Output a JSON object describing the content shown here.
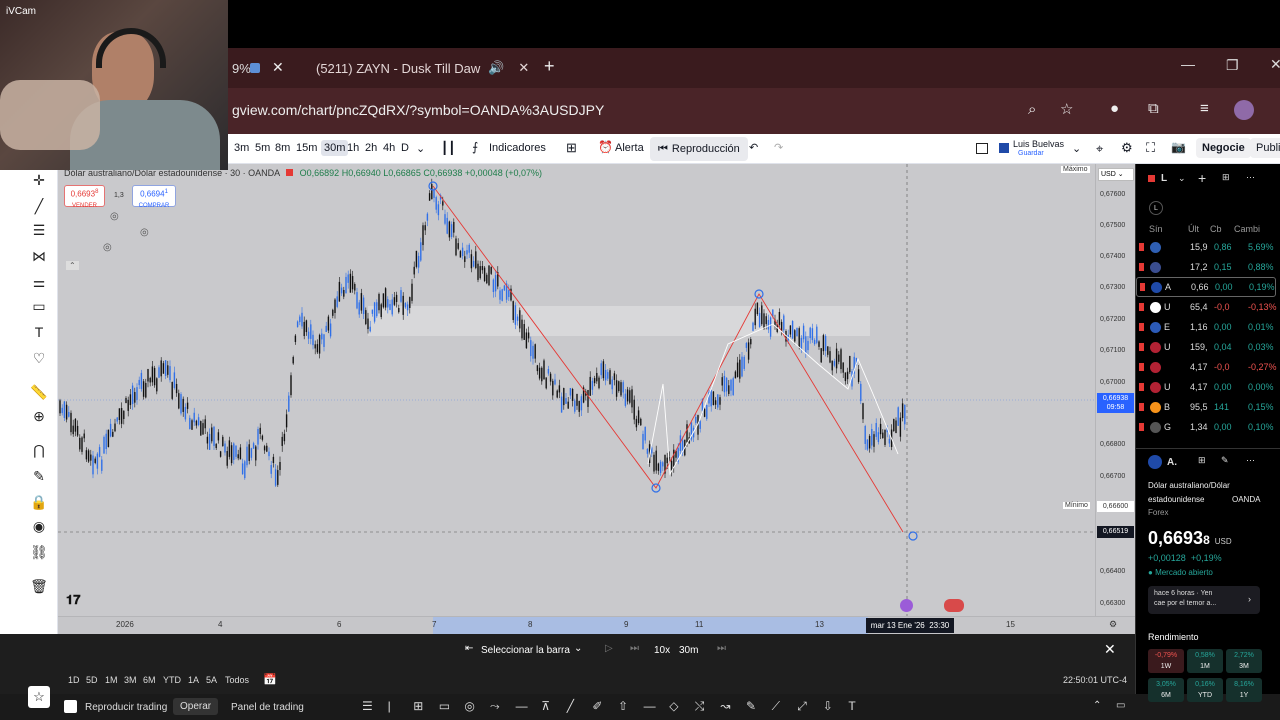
{
  "webcam": {
    "label": "iVCam"
  },
  "browser": {
    "tab_active_fragment": "9%",
    "tab2_title": "(5211) ZAYN - Dusk Till Daw",
    "url": "gview.com/chart/pncZQdRX/?symbol=OANDA%3AUSDJPY"
  },
  "toolbar": {
    "intervals": [
      "3m",
      "5m",
      "8m",
      "15m",
      "30m",
      "1h",
      "2h",
      "4h",
      "D"
    ],
    "active_interval": "30m",
    "indicators": "Indicadores",
    "alert": "Alerta",
    "replay": "Reproducción",
    "user_name": "Luis Buelvas",
    "user_sub": "Guardar",
    "trade": "Negocie",
    "publish": "Publica"
  },
  "legend": {
    "symbol": "Dólar australiano/Dólar estadounidense · 30 · OANDA",
    "o": "O0,66892",
    "h": "H0,66940",
    "l": "L0,66865",
    "c": "C0,66938",
    "chg": "+0,00048 (+0,07%)",
    "sell_price": "0,6693",
    "sell_sup": "8",
    "sell_label": "VENDER",
    "spread": "1,3",
    "buy_price": "0,6694",
    "buy_sup": "1",
    "buy_label": "COMPRAR"
  },
  "price_axis": {
    "currency": "USD",
    "max_label": "Máximo",
    "min_label": "Mínimo",
    "min_value": "0,66600",
    "ticks": [
      "0,67600",
      "0,67500",
      "0,67400",
      "0,67300",
      "0,67200",
      "0,67100",
      "0,67000",
      "0,66800",
      "0,66700",
      "0,66400",
      "0,66300"
    ],
    "current_price": "0,66938",
    "current_time": "09:58",
    "dashed_level": "0,66519"
  },
  "time_axis": {
    "labels": [
      "2026",
      "4",
      "6",
      "7",
      "8",
      "9",
      "11",
      "13",
      "15"
    ],
    "crosshair": "mar 13 Ene '26",
    "crosshair_time": "23:30"
  },
  "replay_bar": {
    "select_bar": "Seleccionar la barra",
    "speed": "10x",
    "interval": "30m"
  },
  "range_bar": {
    "ranges": [
      "1D",
      "5D",
      "1M",
      "3M",
      "6M",
      "YTD",
      "1A",
      "5A",
      "Todos"
    ],
    "clock": "22:50:01 UTC-4"
  },
  "bottom_panel": {
    "replay_trading": "Reproducir trading",
    "operate": "Operar",
    "trading_panel": "Panel de trading"
  },
  "watchlist": {
    "title": "L",
    "section": "L",
    "headers": [
      "Sín",
      "Últ",
      "Cb",
      "Cambi"
    ],
    "rows": [
      {
        "sym": "",
        "last": "15,9",
        "chg": "0,86",
        "pct": "5,69%",
        "dir": "pos",
        "flag": "#2f5fb3"
      },
      {
        "sym": "",
        "last": "17,2",
        "chg": "0,15",
        "pct": "0,88%",
        "dir": "pos",
        "flag": "#3a4d8f"
      },
      {
        "sym": "A",
        "last": "0,66",
        "chg": "0,00",
        "pct": "0,19%",
        "dir": "pos",
        "flag": "#1f4aa8"
      },
      {
        "sym": "U",
        "last": "65,4",
        "chg": "-0,0",
        "pct": "-0,13%",
        "dir": "neg",
        "flag": "#ffffff"
      },
      {
        "sym": "E",
        "last": "1,16",
        "chg": "0,00",
        "pct": "0,01%",
        "dir": "pos",
        "flag": "#2c5bb8"
      },
      {
        "sym": "U",
        "last": "159,",
        "chg": "0,04",
        "pct": "0,03%",
        "dir": "pos",
        "flag": "#b22234"
      },
      {
        "sym": "",
        "last": "4,17",
        "chg": "-0,0",
        "pct": "-0,27%",
        "dir": "neg",
        "flag": "#b22234"
      },
      {
        "sym": "U",
        "last": "4,17",
        "chg": "0,00",
        "pct": "0,00%",
        "dir": "pos",
        "flag": "#b22234"
      },
      {
        "sym": "B",
        "last": "95,5",
        "chg": "141",
        "pct": "0,15%",
        "dir": "pos",
        "flag": "#f7931a"
      },
      {
        "sym": "G",
        "last": "1,34",
        "chg": "0,00",
        "pct": "0,10%",
        "dir": "pos",
        "flag": "#555555"
      }
    ]
  },
  "details": {
    "title": "A.",
    "name_line1": "Dólar australiano/Dólar",
    "name_line2": "estadounidense",
    "exchange": "OANDA",
    "category": "Forex",
    "price": "0,6693",
    "price_sup": "8",
    "currency": "USD",
    "change": "+0,00128",
    "change_pct": "+0,19%",
    "market_status": "Mercado abierto",
    "news_line1": "hace 6 horas · Yen",
    "news_line2": "cae por el temor a...",
    "performance_title": "Rendimiento",
    "performance": [
      {
        "value": "-0,79%",
        "label": "1W",
        "dir": "neg"
      },
      {
        "value": "0,58%",
        "label": "1M",
        "dir": "pos"
      },
      {
        "value": "2,72%",
        "label": "3M",
        "dir": "pos"
      },
      {
        "value": "3,05%",
        "label": "6M",
        "dir": "pos"
      },
      {
        "value": "0,16%",
        "label": "YTD",
        "dir": "pos"
      },
      {
        "value": "8,16%",
        "label": "1Y",
        "dir": "pos"
      }
    ]
  }
}
